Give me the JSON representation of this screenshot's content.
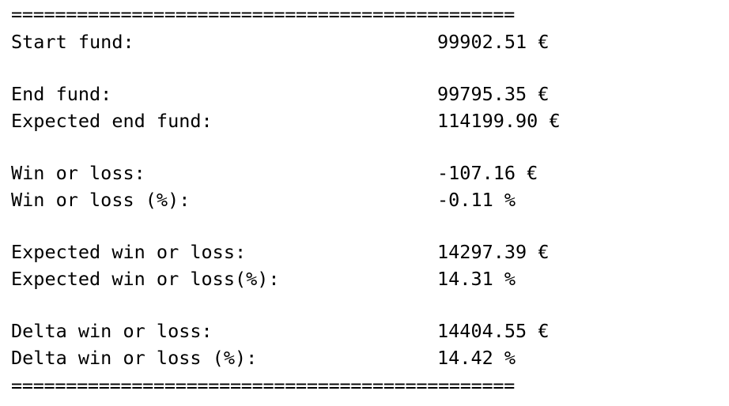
{
  "separator": "==============================================",
  "rows": [
    {
      "label": "Start fund:",
      "value": "99902.51 €"
    },
    {
      "label": "End fund:",
      "value": "99795.35 €"
    },
    {
      "label": "Expected end fund:",
      "value": "114199.90 €"
    },
    {
      "label": "Win or loss:",
      "value": "-107.16 €"
    },
    {
      "label": "Win or loss (%):",
      "value": "-0.11 %"
    },
    {
      "label": "Expected win or loss:",
      "value": "14297.39 €"
    },
    {
      "label": "Expected win or loss(%):",
      "value": "14.31 %"
    },
    {
      "label": "Delta win or loss:",
      "value": "14404.55 €"
    },
    {
      "label": "Delta win or loss (%):",
      "value": "14.42 %"
    }
  ]
}
